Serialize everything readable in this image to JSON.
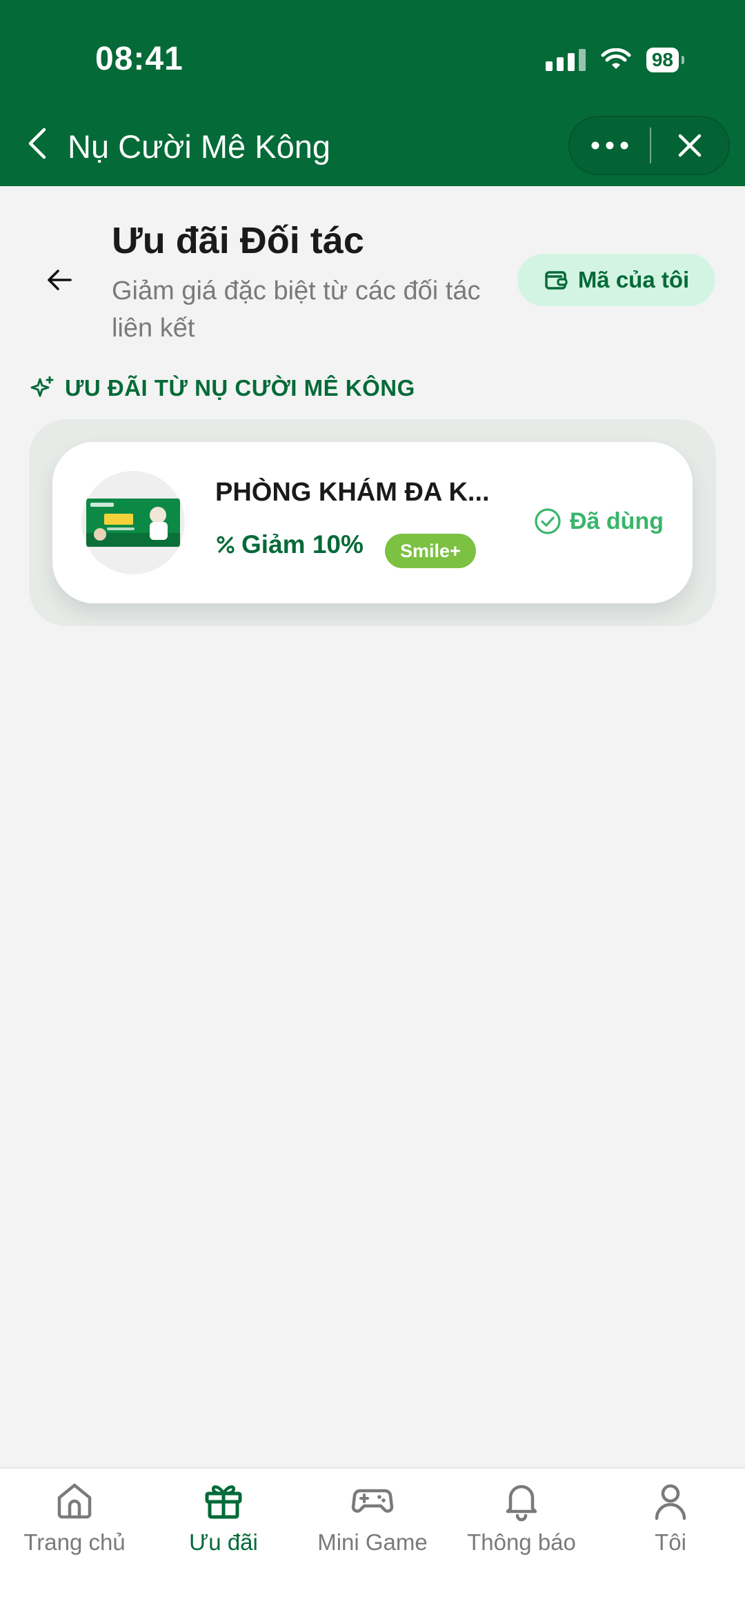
{
  "status_bar": {
    "time": "08:41",
    "battery": "98"
  },
  "app_bar": {
    "title": "Nụ Cười Mê Kông"
  },
  "page": {
    "title": "Ưu đãi Đối tác",
    "subtitle": "Giảm giá đặc biệt từ các đối tác liên kết",
    "my_code_label": "Mã của tôi"
  },
  "section": {
    "title": "ƯU ĐÃI TỪ NỤ CƯỜI MÊ KÔNG"
  },
  "offers": [
    {
      "partner": "PHÒNG KHÁM ĐA K...",
      "discount": "Giảm 10%",
      "badge": "Smile+",
      "status": "Đã dùng"
    }
  ],
  "tabs": [
    {
      "label": "Trang chủ",
      "icon": "home-icon",
      "active": false
    },
    {
      "label": "Ưu đãi",
      "icon": "gift-icon",
      "active": true
    },
    {
      "label": "Mini Game",
      "icon": "gamepad-icon",
      "active": false
    },
    {
      "label": "Thông báo",
      "icon": "bell-icon",
      "active": false
    },
    {
      "label": "Tôi",
      "icon": "user-icon",
      "active": false
    }
  ],
  "colors": {
    "brand": "#046a38",
    "accent_light": "#d3f4e3",
    "badge": "#7cc142",
    "used": "#39b56a"
  }
}
